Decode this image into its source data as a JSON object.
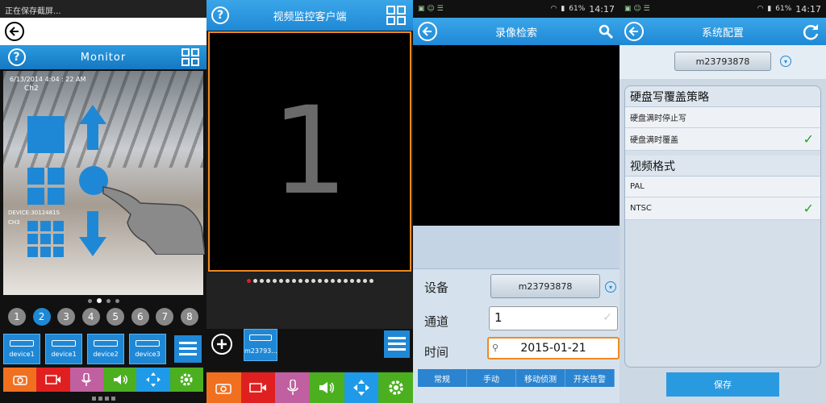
{
  "p1": {
    "status": "正在保存截屏...",
    "title": "Monitor",
    "osd_time": "6/13/2014 4:04 : 22 AM",
    "osd_ch": "Ch2",
    "osd_device": "DEVICE:3012481S",
    "osd_ch2": "CH3",
    "channels": [
      "1",
      "2",
      "3",
      "4",
      "5",
      "6",
      "7",
      "8"
    ],
    "active_channel": "2",
    "devices": [
      "device1",
      "device1",
      "device2",
      "device3"
    ]
  },
  "p2": {
    "title": "视频监控客户端",
    "big_number": "1",
    "device_chip": "m23793...",
    "dots_total": 20
  },
  "p3": {
    "clock": "14:17",
    "battery": "61%",
    "title": "录像检索",
    "device_label": "设备",
    "device_value": "m23793878",
    "channel_label": "通道",
    "channel_value": "1",
    "time_label": "时间",
    "time_value": "2015-01-21",
    "tabs": [
      "常规",
      "手动",
      "移动侦测",
      "开关告警"
    ]
  },
  "p4": {
    "clock": "14:17",
    "battery": "61%",
    "title": "系统配置",
    "device_value": "m23793878",
    "section1": "硬盘写覆盖策略",
    "opt1a": "硬盘满时停止写",
    "opt1b": "硬盘满时覆盖",
    "section2": "视频格式",
    "opt2a": "PAL",
    "opt2b": "NTSC",
    "save": "保存"
  },
  "colors": {
    "accent": "#1f88d6",
    "record_red": "#e02020",
    "mic_pink": "#c060a0",
    "green": "#4caf20",
    "orange": "#f07020"
  }
}
